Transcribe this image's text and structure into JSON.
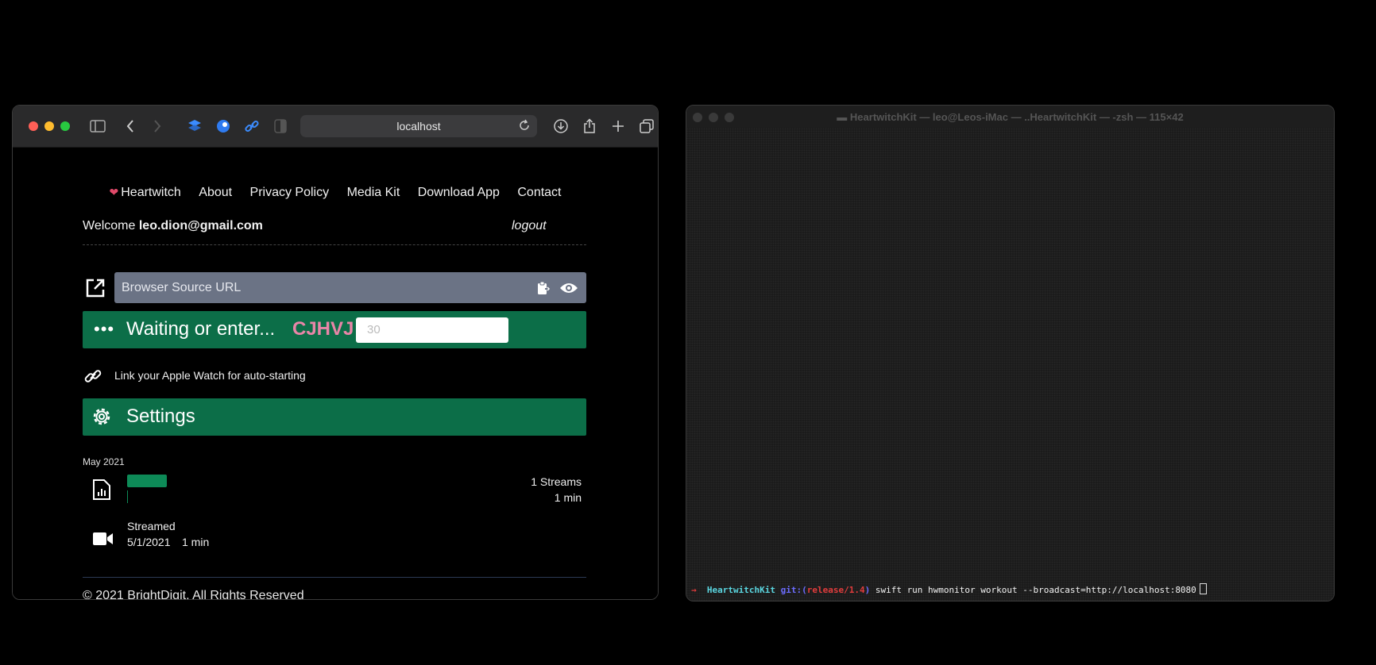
{
  "browser": {
    "address": "localhost",
    "nav": {
      "brand": "Heartwitch",
      "items": [
        "About",
        "Privacy Policy",
        "Media Kit",
        "Download App",
        "Contact"
      ]
    },
    "welcome_prefix": "Welcome",
    "user_email": "leo.dion@gmail.com",
    "logout": "logout",
    "browser_source_placeholder": "Browser Source URL",
    "waiting_label": "Waiting or enter...",
    "waiting_code": "CJHVJ",
    "waiting_input_placeholder": "30",
    "watch_link_text": "Link your Apple Watch for auto-starting",
    "settings_label": "Settings",
    "month": "May 2021",
    "stats": {
      "streams": "1 Streams",
      "duration": "1 min"
    },
    "video": {
      "label": "Streamed",
      "date": "5/1/2021",
      "length": "1 min"
    },
    "footer": "© 2021 BrightDigit. All Rights Reserved",
    "colors": {
      "accent_green": "#0c6e48",
      "code_pink": "#e985a8",
      "input_gray": "#6b7385"
    }
  },
  "terminal": {
    "title": "HeartwitchKit — leo@Leos-iMac — ..HeartwitchKit — -zsh — 115×42",
    "prompt_arrow": "→",
    "prompt_dir": "HeartwitchKit",
    "prompt_git": "git:(",
    "prompt_branch": "release/1.4",
    "prompt_git_close": ")",
    "command": "swift run hwmonitor workout --broadcast=http://localhost:8080"
  }
}
